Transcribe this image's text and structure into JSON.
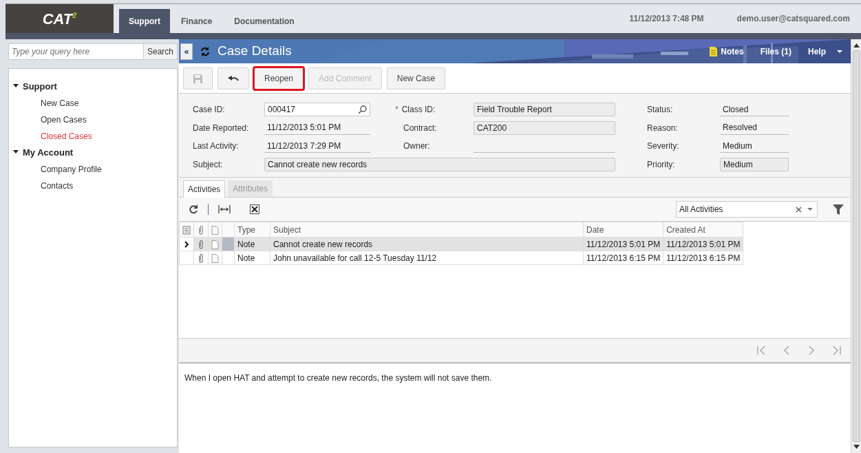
{
  "logo": {
    "text": "CAT",
    "sup": "2"
  },
  "top_tabs": [
    {
      "label": "Support",
      "selected": true
    },
    {
      "label": "Finance",
      "selected": false
    },
    {
      "label": "Documentation",
      "selected": false
    }
  ],
  "datetime": "11/12/2013  7:48 PM",
  "user": "demo.user@catsquared.com",
  "sidebar": {
    "search": {
      "placeholder": "Type your query here",
      "button": "Search"
    },
    "tree": [
      {
        "label": "Support",
        "expanded": true,
        "children": [
          {
            "label": "New Case",
            "selected": false
          },
          {
            "label": "Open Cases",
            "selected": false
          },
          {
            "label": "Closed Cases",
            "selected": true
          }
        ]
      },
      {
        "label": "My Account",
        "expanded": true,
        "children": [
          {
            "label": "Company Profile",
            "selected": false
          },
          {
            "label": "Contacts",
            "selected": false
          }
        ]
      }
    ]
  },
  "collapse_button": "«",
  "page_title": "Case Details",
  "header_links": [
    {
      "kind": "notes",
      "label": "Notes"
    },
    {
      "kind": "plain",
      "label": "Files (1)"
    },
    {
      "kind": "menu",
      "label": "Help"
    }
  ],
  "toolbar": [
    {
      "kind": "save",
      "disabled": true,
      "highlighted": false
    },
    {
      "kind": "undo",
      "disabled": false,
      "highlighted": false
    },
    {
      "kind": "text",
      "label": "Reopen",
      "disabled": false,
      "highlighted": true
    },
    {
      "kind": "text",
      "label": "Add Comment",
      "disabled": true,
      "highlighted": false
    },
    {
      "kind": "text",
      "label": "New Case",
      "disabled": false,
      "highlighted": false
    }
  ],
  "form": {
    "columns": [
      [
        {
          "label": "Case ID:",
          "value": "000417",
          "kind": "selector"
        },
        {
          "label": "Date Reported:",
          "value": "11/12/2013 5:01 PM",
          "kind": "display"
        },
        {
          "label": "Last Activity:",
          "value": "11/12/2013 7:29 PM",
          "kind": "display"
        }
      ],
      [
        {
          "label": "Class ID:",
          "value": "Field Trouble Report",
          "kind": "box",
          "required_mark": "*"
        },
        {
          "label": "Contract:",
          "value": "CAT200",
          "kind": "box"
        },
        {
          "label": "Owner:",
          "kind": "display"
        }
      ],
      [
        {
          "label": "Status:",
          "value": "Closed",
          "kind": "display"
        },
        {
          "label": "Reason:",
          "value": "Resolved",
          "kind": "display"
        },
        {
          "label": "Severity:",
          "value": "Medium",
          "kind": "display"
        },
        {
          "label": "Priority:",
          "value": "Medium",
          "kind": "box"
        }
      ]
    ],
    "subject": {
      "label": "Subject:",
      "value": "Cannot create new records",
      "kind": "box"
    }
  },
  "tabs": [
    {
      "label": "Activities",
      "selected": true
    },
    {
      "label": "Attributes",
      "selected": false
    }
  ],
  "filter": {
    "value": "All Activities"
  },
  "table": {
    "columns": [
      "Type",
      "Subject",
      "Date",
      "Created At"
    ],
    "rows": [
      {
        "selected": true,
        "has_attachment": true,
        "cells": [
          "Note",
          "Cannot create new records",
          "11/12/2013 5:01 PM",
          "11/12/2013 5:01 PM"
        ]
      },
      {
        "selected": false,
        "has_attachment": true,
        "cells": [
          "Note",
          "John unavailable for call 12-5 Tuesday 11/12",
          "11/12/2013 6:15 PM",
          "11/12/2013 6:15 PM"
        ]
      }
    ]
  },
  "description": "When I open HAT and attempt to create new records, the system will not save them."
}
